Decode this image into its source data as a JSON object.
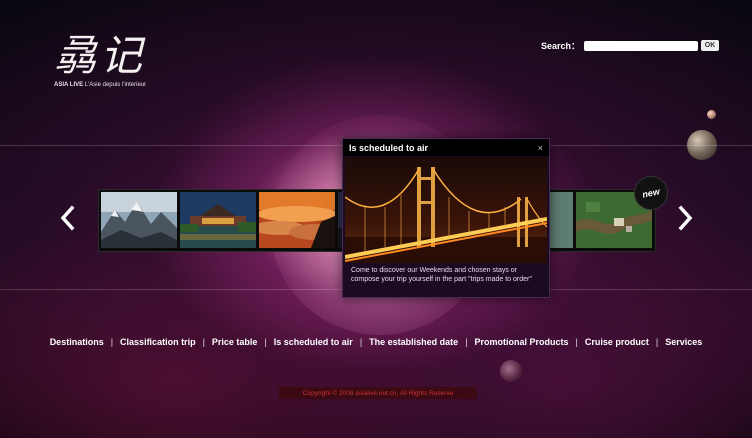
{
  "logo": {
    "glyphs": "骉记",
    "brand": "ASIA LIVE",
    "tagline": "L'Asie depuis l'interieur"
  },
  "search": {
    "label": "Search：",
    "value": "",
    "button": "OK"
  },
  "carousel": {
    "prev_icon": "chevron-left-icon",
    "next_icon": "chevron-right-icon",
    "new_badge": "new",
    "thumbnails": [
      "snowy-mountains",
      "palace-lake",
      "sunset-clouds",
      "city-dusk",
      "coast-aerial",
      "river-delta"
    ]
  },
  "popup": {
    "title": "Is scheduled to air",
    "close": "×",
    "image": "suspension-bridge-night",
    "text": "Come to discover our Weekends and chosen stays or compose your trip yourself in the part \"trips made to order\""
  },
  "nav": {
    "items": [
      "Destinations",
      "Classification trip",
      "Price table",
      "Is scheduled to air",
      "The established date",
      "Promotional Products",
      "Cruise product",
      "Services"
    ],
    "separator": "|"
  },
  "footer": {
    "copyright": "Copyright © 2008 asialive.net.cn, All Rights Reserve"
  },
  "colors": {
    "accent": "#4a1f5a",
    "footer_text": "#cc3333"
  }
}
